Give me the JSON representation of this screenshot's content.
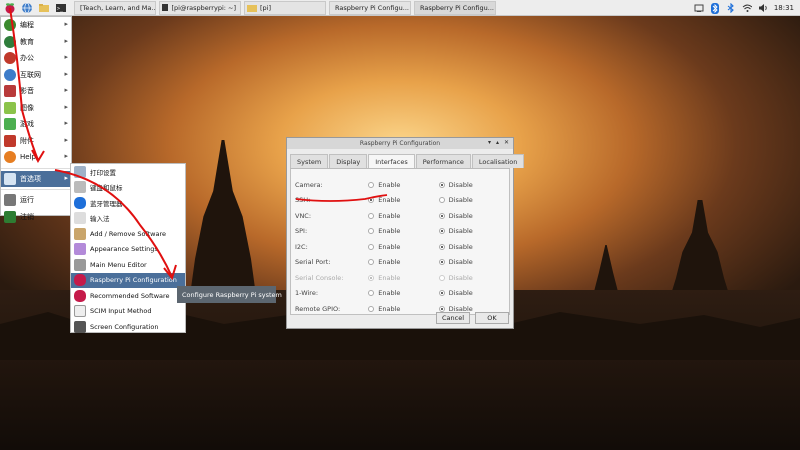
{
  "taskbar": {
    "tasks": [
      {
        "label": "[Teach, Learn, and Ma..."
      },
      {
        "label": "[pi@raspberrypi: ~]"
      },
      {
        "label": "[pi]"
      },
      {
        "label": "Raspberry Pi Configu..."
      },
      {
        "label": "Raspberry Pi Configu..."
      }
    ],
    "clock": "18:31"
  },
  "main_menu": {
    "items": [
      {
        "label": "编程"
      },
      {
        "label": "教育"
      },
      {
        "label": "办公"
      },
      {
        "label": "互联网"
      },
      {
        "label": "影音"
      },
      {
        "label": "图像"
      },
      {
        "label": "游戏"
      },
      {
        "label": "附件"
      },
      {
        "label": "Help"
      },
      {
        "label": "首选项"
      },
      {
        "label": "运行"
      },
      {
        "label": "注销"
      }
    ]
  },
  "sub_menu": {
    "items": [
      {
        "label": "打印设置"
      },
      {
        "label": "键盘和鼠标"
      },
      {
        "label": "蓝牙管理器"
      },
      {
        "label": "输入法"
      },
      {
        "label": "Add / Remove Software"
      },
      {
        "label": "Appearance Settings"
      },
      {
        "label": "Main Menu Editor"
      },
      {
        "label": "Raspberry Pi Configuration"
      },
      {
        "label": "Recommended Software"
      },
      {
        "label": "SCIM Input Method"
      },
      {
        "label": "Screen Configuration"
      }
    ],
    "tooltip": "Configure Raspberry Pi system"
  },
  "dialog": {
    "title": "Raspberry Pi Configuration",
    "tabs": [
      {
        "label": "System"
      },
      {
        "label": "Display"
      },
      {
        "label": "Interfaces"
      },
      {
        "label": "Performance"
      },
      {
        "label": "Localisation"
      }
    ],
    "enable_label": "Enable",
    "disable_label": "Disable",
    "rows": [
      {
        "label": "Camera:"
      },
      {
        "label": "SSH:"
      },
      {
        "label": "VNC:"
      },
      {
        "label": "SPI:"
      },
      {
        "label": "I2C:"
      },
      {
        "label": "Serial Port:"
      },
      {
        "label": "Serial Console:"
      },
      {
        "label": "1-Wire:"
      },
      {
        "label": "Remote GPIO:"
      }
    ],
    "cancel_label": "Cancel",
    "ok_label": "OK"
  }
}
